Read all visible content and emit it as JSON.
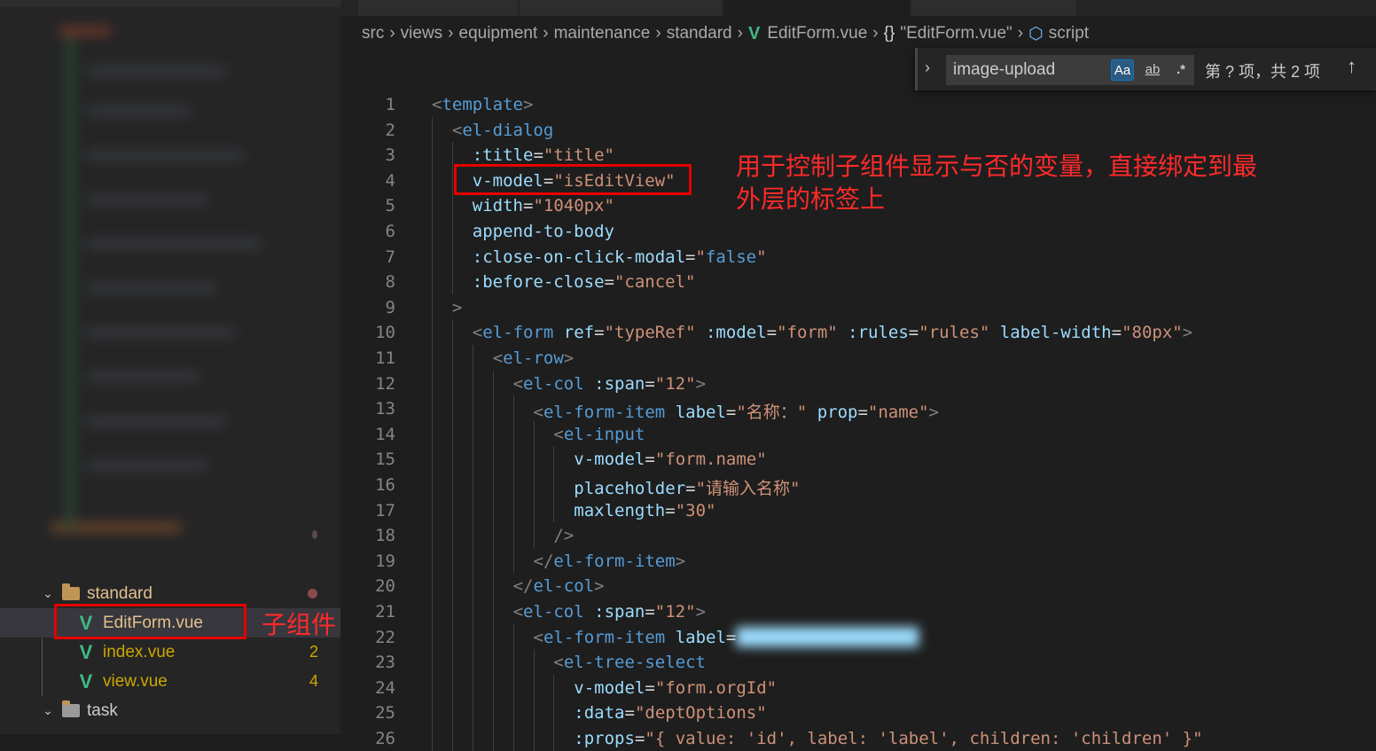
{
  "sidebar": {
    "folders": [
      {
        "name": "standard",
        "expanded": true
      },
      {
        "name": "task",
        "expanded": true
      }
    ],
    "files": [
      {
        "name": "EditForm.vue",
        "badge": "",
        "active": true
      },
      {
        "name": "index.vue",
        "badge": "2",
        "active": false
      },
      {
        "name": "view.vue",
        "badge": "4",
        "active": false
      }
    ]
  },
  "breadcrumb": {
    "segments": [
      "src",
      "views",
      "equipment",
      "maintenance",
      "standard"
    ],
    "file": "EditForm.vue",
    "component": "\"EditForm.vue\"",
    "section": "script"
  },
  "find": {
    "query": "image-upload",
    "match_case_label": "Aa",
    "whole_word_label": "ab",
    "regex_label": ".*",
    "result_text": "第 ? 项，共 2 项"
  },
  "annotations": {
    "note_line1": "用于控制子组件显示与否的变量，直接绑定到最",
    "note_line2": "外层的标签上",
    "child_label": "子组件"
  },
  "code": [
    {
      "n": "1",
      "indent": 0,
      "tokens": [
        [
          "punc",
          "<"
        ],
        [
          "tag",
          "template"
        ],
        [
          "punc",
          ">"
        ]
      ]
    },
    {
      "n": "2",
      "indent": 1,
      "tokens": [
        [
          "punc",
          "<"
        ],
        [
          "tag",
          "el-dialog"
        ]
      ]
    },
    {
      "n": "3",
      "indent": 2,
      "tokens": [
        [
          "attr",
          ":title"
        ],
        [
          "eq",
          "="
        ],
        [
          "str",
          "\"title\""
        ]
      ]
    },
    {
      "n": "4",
      "indent": 2,
      "tokens": [
        [
          "attr",
          "v-model"
        ],
        [
          "eq",
          "="
        ],
        [
          "str",
          "\"isEditView\""
        ]
      ]
    },
    {
      "n": "5",
      "indent": 2,
      "tokens": [
        [
          "attr",
          "width"
        ],
        [
          "eq",
          "="
        ],
        [
          "str",
          "\"1040px\""
        ]
      ]
    },
    {
      "n": "6",
      "indent": 2,
      "tokens": [
        [
          "attr",
          "append-to-body"
        ]
      ]
    },
    {
      "n": "7",
      "indent": 2,
      "tokens": [
        [
          "attr",
          ":close-on-click-modal"
        ],
        [
          "eq",
          "="
        ],
        [
          "str",
          "\""
        ],
        [
          "bool",
          "false"
        ],
        [
          "str",
          "\""
        ]
      ]
    },
    {
      "n": "8",
      "indent": 2,
      "tokens": [
        [
          "attr",
          ":before-close"
        ],
        [
          "eq",
          "="
        ],
        [
          "str",
          "\"cancel\""
        ]
      ]
    },
    {
      "n": "9",
      "indent": 1,
      "tokens": [
        [
          "punc",
          ">"
        ]
      ]
    },
    {
      "n": "10",
      "indent": 2,
      "tokens": [
        [
          "punc",
          "<"
        ],
        [
          "tag",
          "el-form"
        ],
        [
          "eq",
          " "
        ],
        [
          "attr",
          "ref"
        ],
        [
          "eq",
          "="
        ],
        [
          "str",
          "\"typeRef\""
        ],
        [
          "eq",
          " "
        ],
        [
          "attr",
          ":model"
        ],
        [
          "eq",
          "="
        ],
        [
          "str",
          "\"form\""
        ],
        [
          "eq",
          " "
        ],
        [
          "attr",
          ":rules"
        ],
        [
          "eq",
          "="
        ],
        [
          "str",
          "\"rules\""
        ],
        [
          "eq",
          " "
        ],
        [
          "attr",
          "label-width"
        ],
        [
          "eq",
          "="
        ],
        [
          "str",
          "\"80px\""
        ],
        [
          "punc",
          ">"
        ]
      ]
    },
    {
      "n": "11",
      "indent": 3,
      "tokens": [
        [
          "punc",
          "<"
        ],
        [
          "tag",
          "el-row"
        ],
        [
          "punc",
          ">"
        ]
      ]
    },
    {
      "n": "12",
      "indent": 4,
      "tokens": [
        [
          "punc",
          "<"
        ],
        [
          "tag",
          "el-col"
        ],
        [
          "eq",
          " "
        ],
        [
          "attr",
          ":span"
        ],
        [
          "eq",
          "="
        ],
        [
          "str",
          "\"12\""
        ],
        [
          "punc",
          ">"
        ]
      ]
    },
    {
      "n": "13",
      "indent": 5,
      "tokens": [
        [
          "punc",
          "<"
        ],
        [
          "tag",
          "el-form-item"
        ],
        [
          "eq",
          " "
        ],
        [
          "attr",
          "label"
        ],
        [
          "eq",
          "="
        ],
        [
          "str",
          "\"名称：\""
        ],
        [
          "eq",
          " "
        ],
        [
          "attr",
          "prop"
        ],
        [
          "eq",
          "="
        ],
        [
          "str",
          "\"name\""
        ],
        [
          "punc",
          ">"
        ]
      ]
    },
    {
      "n": "14",
      "indent": 6,
      "tokens": [
        [
          "punc",
          "<"
        ],
        [
          "tag",
          "el-input"
        ]
      ]
    },
    {
      "n": "15",
      "indent": 7,
      "tokens": [
        [
          "attr",
          "v-model"
        ],
        [
          "eq",
          "="
        ],
        [
          "str",
          "\"form.name\""
        ]
      ]
    },
    {
      "n": "16",
      "indent": 7,
      "tokens": [
        [
          "attr",
          "placeholder"
        ],
        [
          "eq",
          "="
        ],
        [
          "str",
          "\"请输入名称\""
        ]
      ]
    },
    {
      "n": "17",
      "indent": 7,
      "tokens": [
        [
          "attr",
          "maxlength"
        ],
        [
          "eq",
          "="
        ],
        [
          "str",
          "\"30\""
        ]
      ]
    },
    {
      "n": "18",
      "indent": 6,
      "tokens": [
        [
          "punc",
          "/>"
        ]
      ]
    },
    {
      "n": "19",
      "indent": 5,
      "tokens": [
        [
          "punc",
          "</"
        ],
        [
          "tag",
          "el-form-item"
        ],
        [
          "punc",
          ">"
        ]
      ]
    },
    {
      "n": "20",
      "indent": 4,
      "tokens": [
        [
          "punc",
          "</"
        ],
        [
          "tag",
          "el-col"
        ],
        [
          "punc",
          ">"
        ]
      ]
    },
    {
      "n": "21",
      "indent": 4,
      "tokens": [
        [
          "punc",
          "<"
        ],
        [
          "tag",
          "el-col"
        ],
        [
          "eq",
          " "
        ],
        [
          "attr",
          ":span"
        ],
        [
          "eq",
          "="
        ],
        [
          "str",
          "\"12\""
        ],
        [
          "punc",
          ">"
        ]
      ]
    },
    {
      "n": "22",
      "indent": 5,
      "tokens": [
        [
          "punc",
          "<"
        ],
        [
          "tag",
          "el-form-item"
        ],
        [
          "eq",
          " "
        ],
        [
          "attr",
          "label"
        ],
        [
          "eq",
          "="
        ]
      ],
      "blurred_tail": true
    },
    {
      "n": "23",
      "indent": 6,
      "tokens": [
        [
          "punc",
          "<"
        ],
        [
          "tag",
          "el-tree-select"
        ]
      ]
    },
    {
      "n": "24",
      "indent": 7,
      "tokens": [
        [
          "attr",
          "v-model"
        ],
        [
          "eq",
          "="
        ],
        [
          "str",
          "\"form.orgId\""
        ]
      ]
    },
    {
      "n": "25",
      "indent": 7,
      "tokens": [
        [
          "attr",
          ":data"
        ],
        [
          "eq",
          "="
        ],
        [
          "str",
          "\"deptOptions\""
        ]
      ]
    },
    {
      "n": "26",
      "indent": 7,
      "tokens": [
        [
          "attr",
          ":props"
        ],
        [
          "eq",
          "="
        ],
        [
          "str",
          "\"{ value: 'id', label: 'label', children: 'children' }\""
        ]
      ]
    }
  ]
}
